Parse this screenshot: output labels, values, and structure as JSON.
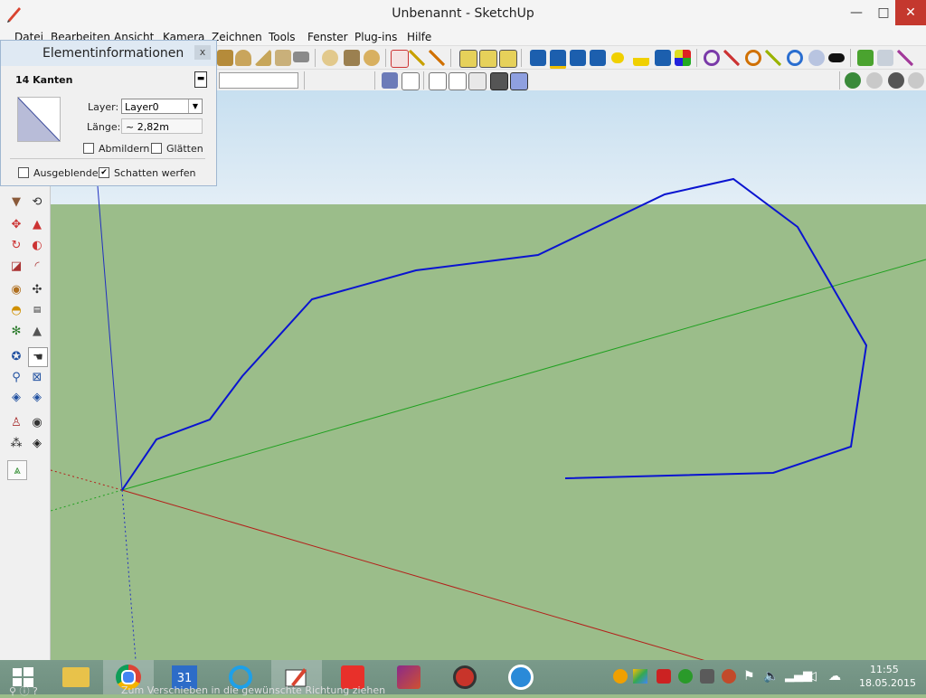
{
  "window": {
    "title": "Unbenannt - SketchUp",
    "minimize_glyph": "—",
    "maximize_glyph": "□",
    "close_glyph": "✕",
    "app_icon": "sketchup-pencil-icon"
  },
  "menu": {
    "items": [
      "Datei",
      "Bearbeiten",
      "Ansicht",
      "Kamera",
      "Zeichnen",
      "Tools",
      "Fenster",
      "Plug-ins",
      "Hilfe"
    ]
  },
  "entity_info": {
    "title": "Elementinformationen",
    "close_glyph": "x",
    "selection": "14 Kanten",
    "layer_label": "Layer:",
    "layer_value": "Layer0",
    "length_label": "Länge:",
    "length_value": "~ 2,82m",
    "soften_label": "Abmildern",
    "soften_checked": false,
    "smooth_label": "Glätten",
    "smooth_checked": false,
    "hidden_label": "Ausgeblendet",
    "hidden_checked": false,
    "cast_shadows_label": "Schatten werfen",
    "cast_shadows_checked": true,
    "checkmark": "✔"
  },
  "viewport": {
    "sky_color": "#d6e8f4",
    "ground_color": "#9bbd8a",
    "curve_color": "#0a14d0",
    "axis_red": "#b3201a",
    "axis_green": "#1fa01f",
    "axis_blue": "#2030c0"
  },
  "taskbar": {
    "apps": [
      "file-explorer-icon",
      "chrome-icon",
      "calendar-icon",
      "internet-explorer-icon",
      "sketchup-icon",
      "office-icon",
      "media-app-icon",
      "download-app-icon",
      "vpn-app-icon"
    ],
    "calendar_day": "31",
    "time": "11:55",
    "date": "18.05.2015",
    "status_text": "Zum Verschieben in die gewünschte Richtung ziehen"
  }
}
